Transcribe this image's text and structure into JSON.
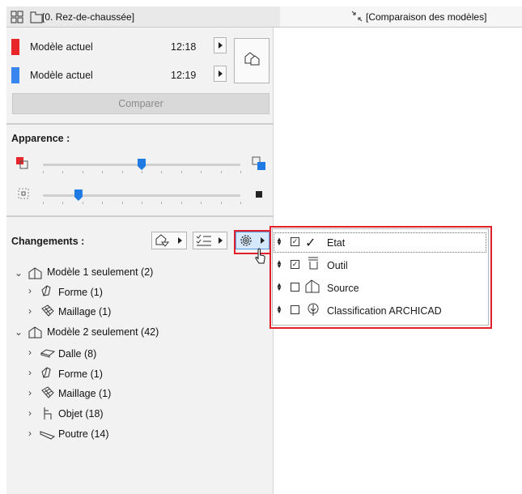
{
  "tabs": {
    "left_title": "[0. Rez-de-chaussée]",
    "right_title": "[Comparaison des modèles]"
  },
  "models": [
    {
      "name": "Modèle actuel",
      "time": "12:18",
      "color": "#e8262a"
    },
    {
      "name": "Modèle actuel",
      "time": "12:19",
      "color": "#3a86f0"
    }
  ],
  "compare_button": "Comparer",
  "appearance": {
    "label": "Apparence :",
    "slider1_value": 0.5,
    "slider2_value": 0.18
  },
  "changes": {
    "label": "Changements :"
  },
  "tree": {
    "group1": {
      "label": "Modèle 1 seulement (2)",
      "children": [
        "Forme (1)",
        "Maillage (1)"
      ]
    },
    "group2": {
      "label": "Modèle 2 seulement (42)",
      "children": [
        "Dalle (8)",
        "Forme (1)",
        "Maillage (1)",
        "Objet (18)",
        "Poutre (14)"
      ]
    }
  },
  "dropdown": {
    "items": [
      {
        "label": "Etat",
        "checked": true
      },
      {
        "label": "Outil",
        "checked": true
      },
      {
        "label": "Source",
        "checked": false
      },
      {
        "label": "Classification ARCHICAD",
        "checked": false
      }
    ]
  },
  "icons": [
    "layout-icon",
    "floor-plan-icon",
    "compare-icon",
    "model-icon",
    "arrow-right-icon",
    "filter-icon",
    "list-icon",
    "gear-icon",
    "check-icon",
    "tool-icon",
    "source-icon",
    "classification-icon",
    "morph-icon",
    "mesh-icon",
    "slab-icon",
    "object-icon",
    "beam-icon",
    "house-icon",
    "mouse-cursor-icon"
  ],
  "accent_color": "#e0202a",
  "slider_color": "#1f7be3"
}
